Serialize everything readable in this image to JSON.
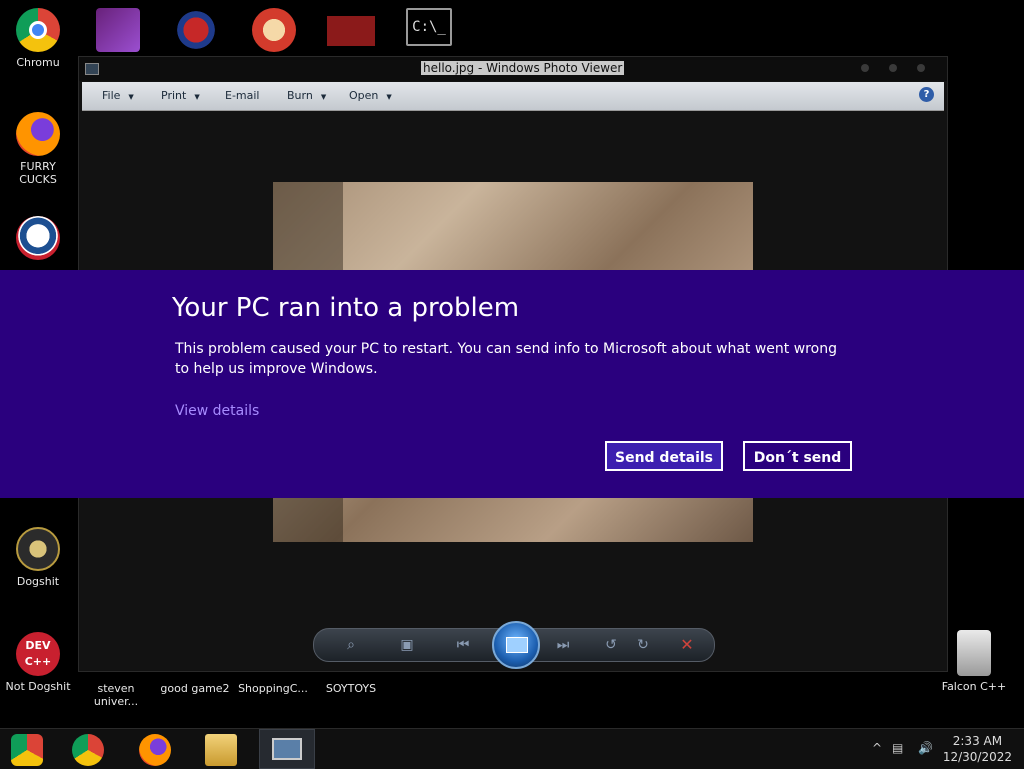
{
  "desktop": {
    "icons_left": [
      {
        "label": "Chromu"
      },
      {
        "label": "FURRY CUCKS"
      },
      {
        "label": "Dogshit"
      },
      {
        "label": "Not Dogshit"
      }
    ],
    "icons_bottom": [
      {
        "label": "steven univer..."
      },
      {
        "label": "good game2"
      },
      {
        "label": "ShoppingC..."
      },
      {
        "label": "SOYTOYS"
      }
    ],
    "icons_right": [
      {
        "label": "Falcon C++"
      }
    ],
    "top_icons": [
      {
        "icon": "visual-studio-icon"
      },
      {
        "icon": "wing-2-icon"
      },
      {
        "icon": "p-app-icon"
      },
      {
        "icon": "papers-please-icon"
      },
      {
        "icon": "command-prompt-icon",
        "text": "C:\\_"
      }
    ]
  },
  "viewer": {
    "title": "hello.jpg - Windows Photo Viewer",
    "menu": [
      {
        "label": "File",
        "has_arrow": true
      },
      {
        "label": "Print",
        "has_arrow": true
      },
      {
        "label": "E-mail",
        "has_arrow": false
      },
      {
        "label": "Burn",
        "has_arrow": true
      },
      {
        "label": "Open",
        "has_arrow": true
      }
    ],
    "help_label": "?"
  },
  "bsod": {
    "title": "Your PC ran into a problem",
    "message": "This problem caused your PC to restart. You can send info to Microsoft about what went wrong to help us improve Windows.",
    "link": "View details",
    "send_button": "Send details",
    "dont_button": "Don´t send",
    "background": "#2a007e"
  },
  "taskbar": {
    "time": "2:33 AM",
    "date": "12/30/2022",
    "tray_chevron": "^"
  }
}
